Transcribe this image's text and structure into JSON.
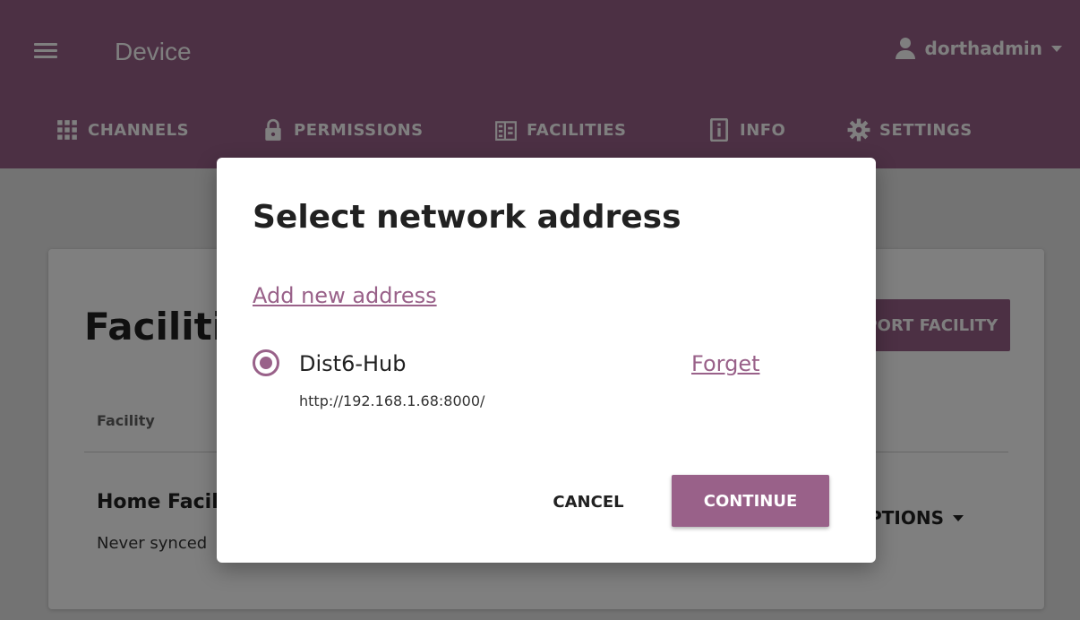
{
  "header": {
    "title": "Device",
    "user": "dorthadmin",
    "tabs": [
      {
        "label": "CHANNELS",
        "icon": "grid-icon"
      },
      {
        "label": "PERMISSIONS",
        "icon": "lock-icon"
      },
      {
        "label": "FACILITIES",
        "icon": "building-icon"
      },
      {
        "label": "INFO",
        "icon": "info-icon"
      },
      {
        "label": "SETTINGS",
        "icon": "gear-icon"
      }
    ]
  },
  "page": {
    "title": "Facilities",
    "import_button": "IMPORT FACILITY",
    "column_header": "Facility",
    "rows": [
      {
        "name": "Home Facility",
        "status": "Never synced",
        "options": "OPTIONS"
      }
    ]
  },
  "dialog": {
    "title": "Select network address",
    "add_link": "Add new address",
    "address": {
      "name": "Dist6-Hub",
      "url": "http://192.168.1.68:8000/",
      "selected": true,
      "forget_label": "Forget"
    },
    "cancel_label": "CANCEL",
    "continue_label": "CONTINUE"
  },
  "colors": {
    "brand": "#996189",
    "overlay": "rgba(0,0,0,0.5)"
  }
}
